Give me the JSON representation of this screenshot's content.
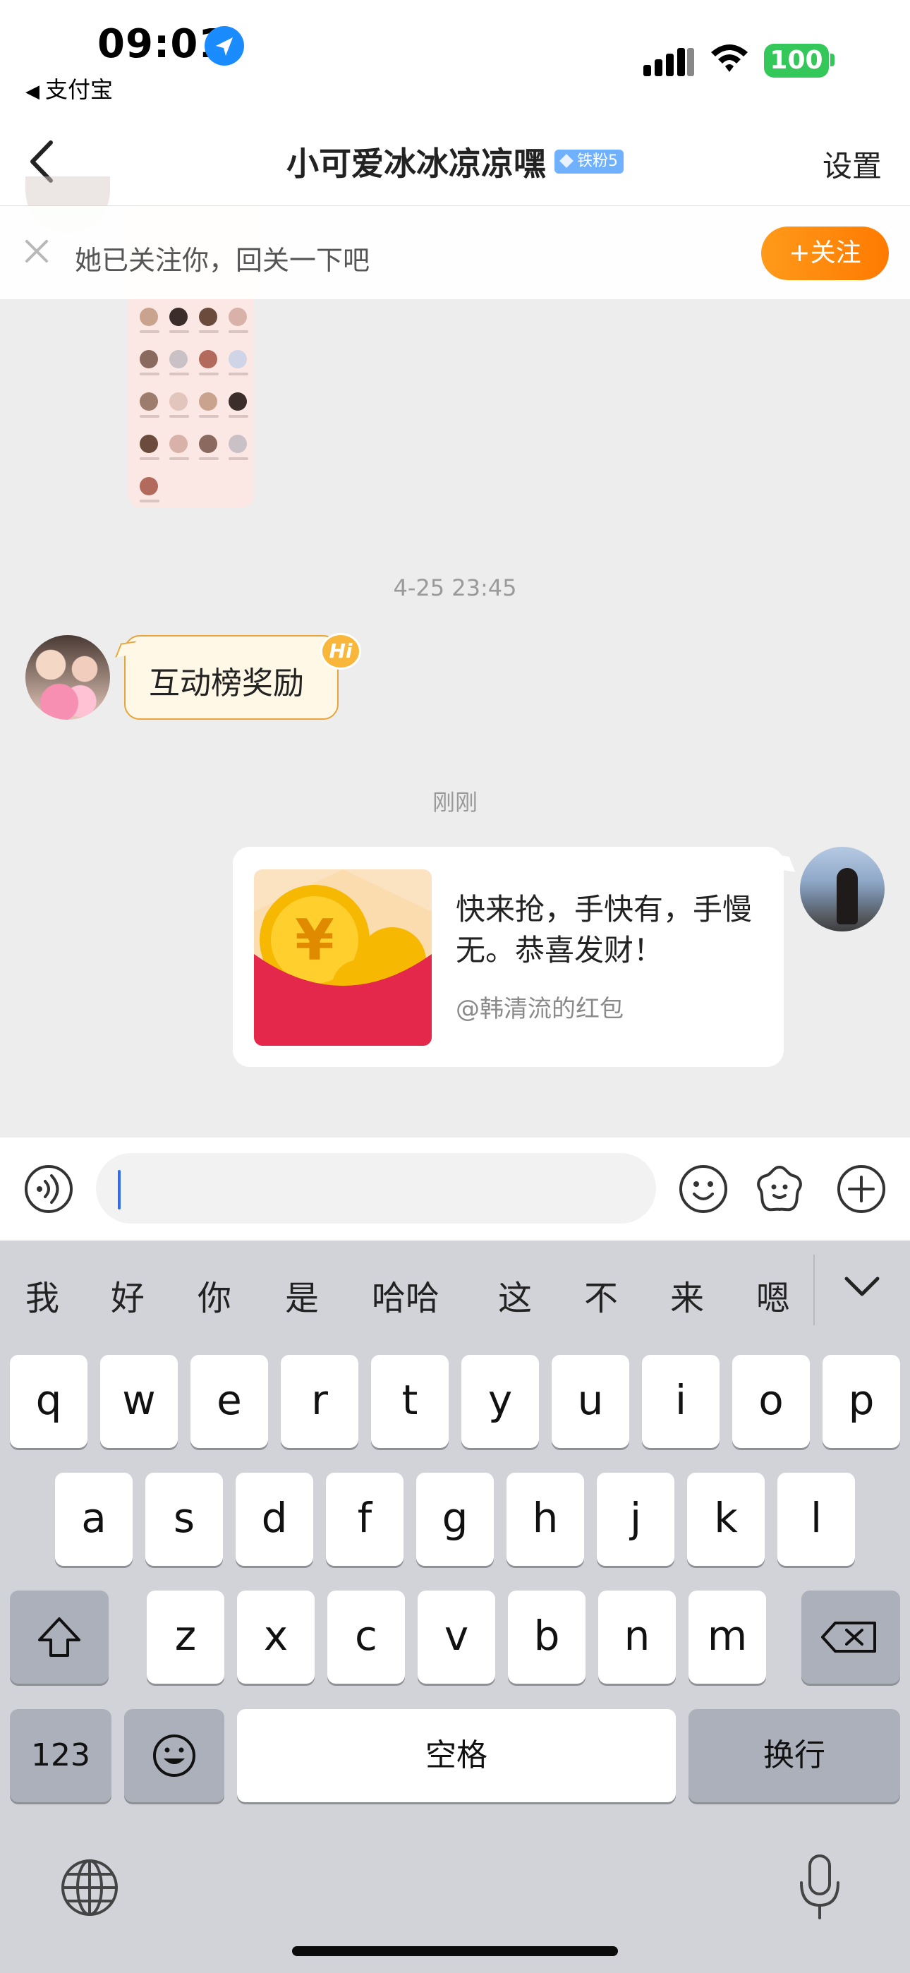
{
  "status_bar": {
    "time": "09:01",
    "back_app_label": "支付宝",
    "battery": "100"
  },
  "nav": {
    "title": "小可爱冰冰凉凉嘿",
    "fan_badge": "铁粉5",
    "settings_label": "设置"
  },
  "banner": {
    "text": "她已关注你，回关一下吧",
    "follow_button": "+关注"
  },
  "chat": {
    "timestamp_1": "4-25 23:45",
    "message_hi": {
      "text": "互动榜奖励",
      "tag": "Hi"
    },
    "timestamp_2": "刚刚",
    "red_packet": {
      "text": "快来抢，手快有，手慢无。恭喜发财！",
      "from": "@韩清流的红包"
    }
  },
  "input": {
    "value": ""
  },
  "keyboard": {
    "suggestions": [
      "我",
      "好",
      "你",
      "是",
      "哈哈",
      "这",
      "不",
      "来",
      "嗯"
    ],
    "row1": [
      "q",
      "w",
      "e",
      "r",
      "t",
      "y",
      "u",
      "i",
      "o",
      "p"
    ],
    "row2": [
      "a",
      "s",
      "d",
      "f",
      "g",
      "h",
      "j",
      "k",
      "l"
    ],
    "row3": [
      "z",
      "x",
      "c",
      "v",
      "b",
      "n",
      "m"
    ],
    "numbers_key": "123",
    "space_key": "空格",
    "return_key": "换行"
  },
  "colors": {
    "accent_orange": "#ff8a00",
    "battery_green": "#34c759",
    "red_packet_red": "#e3284b",
    "caret_blue": "#2e6cf6"
  },
  "icons": {
    "status": [
      "location-arrow-icon",
      "signal-icon",
      "wifi-icon",
      "battery-icon"
    ],
    "nav": [
      "back-chevron-icon"
    ],
    "input_bar": [
      "voice-icon",
      "emoji-icon",
      "sticker-icon",
      "plus-icon"
    ],
    "keyboard": [
      "shift-icon",
      "delete-icon",
      "emoji-key-icon",
      "globe-icon",
      "mic-icon",
      "collapse-chevron-icon"
    ]
  }
}
